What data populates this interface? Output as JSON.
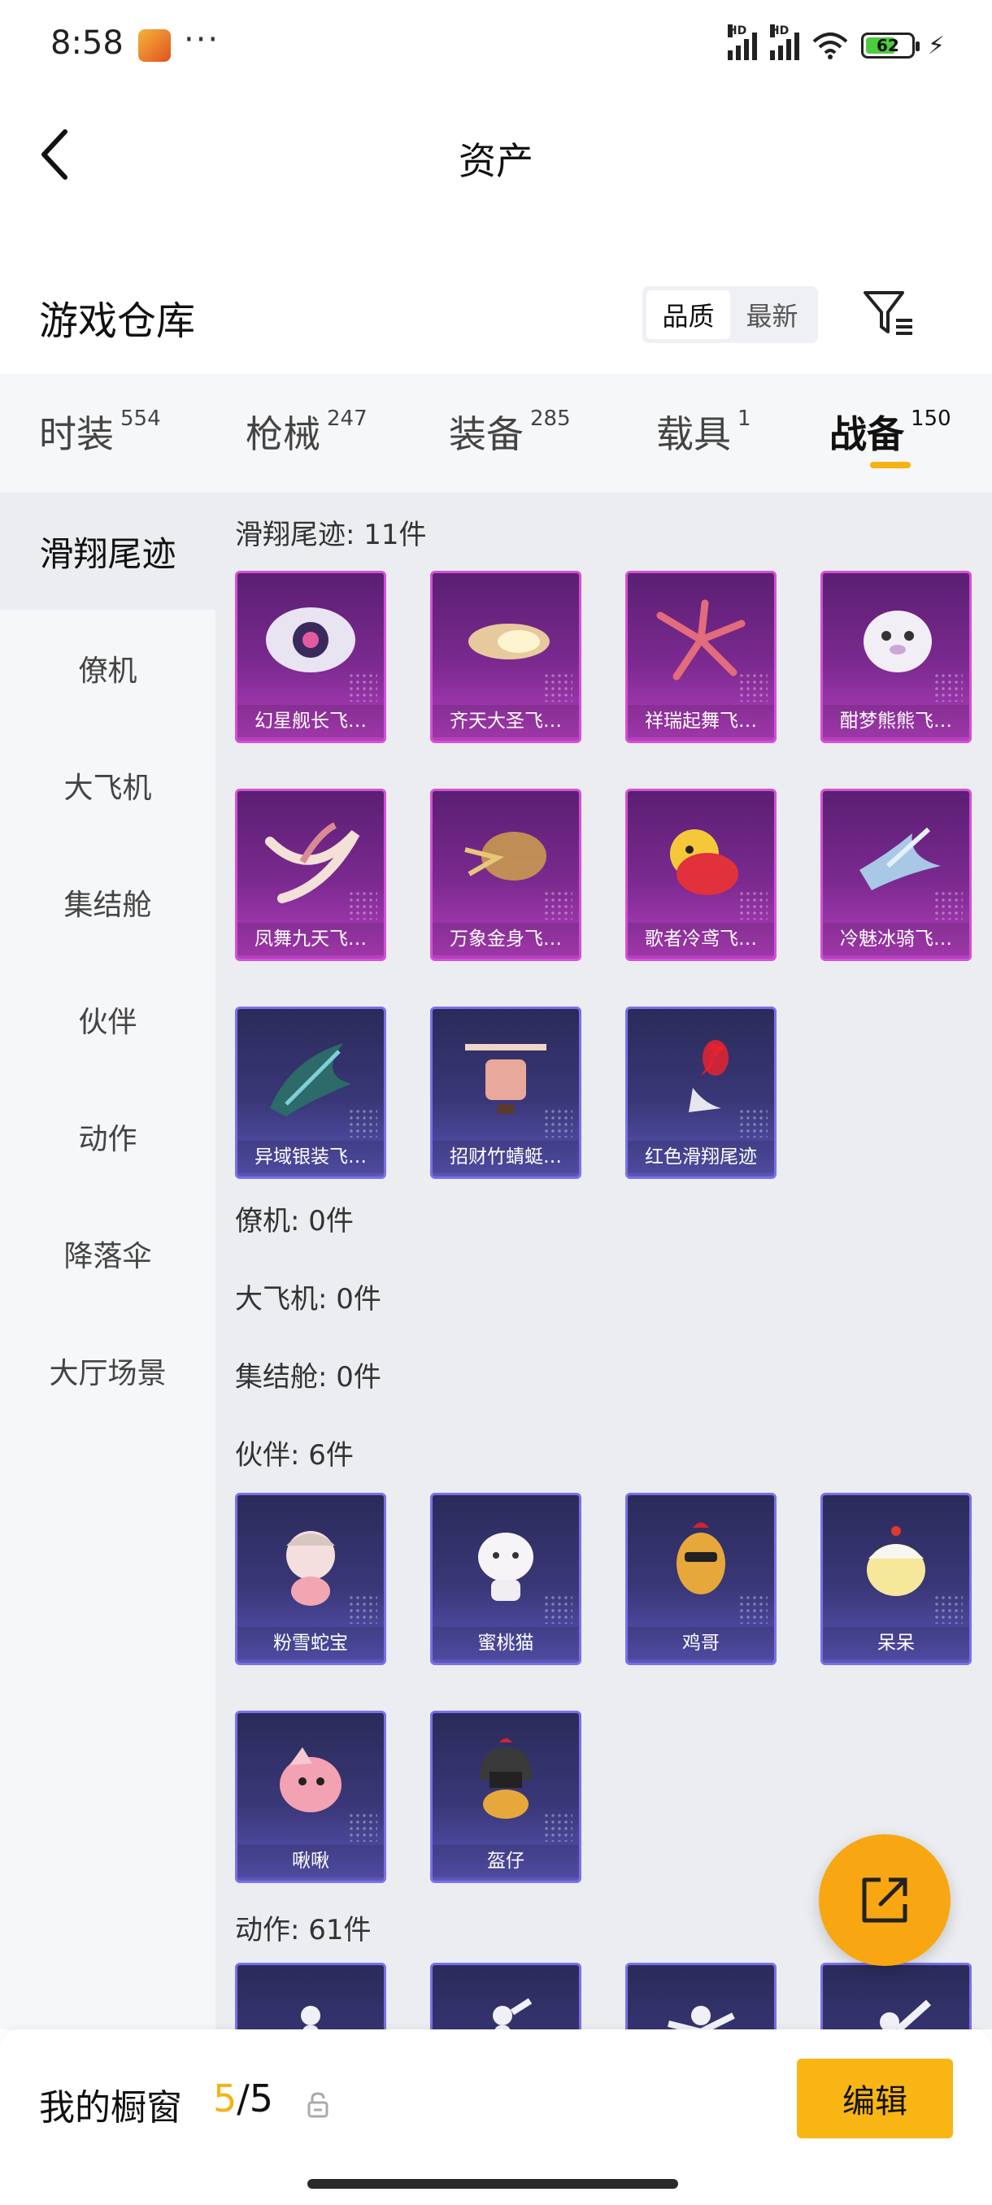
{
  "status_bar": {
    "time": "8:58",
    "dots": "···",
    "hd1": "HD",
    "hd2": "HD",
    "battery": "62"
  },
  "header": {
    "title": "资产"
  },
  "warehouse": {
    "title": "游戏仓库",
    "sort_options": [
      "品质",
      "最新"
    ],
    "active_sort": "品质"
  },
  "tabs": [
    {
      "label": "时装",
      "count": "554"
    },
    {
      "label": "枪械",
      "count": "247"
    },
    {
      "label": "装备",
      "count": "285"
    },
    {
      "label": "载具",
      "count": "1"
    },
    {
      "label": "战备",
      "count": "150"
    }
  ],
  "active_tab": "战备",
  "sidebar": [
    "滑翔尾迹",
    "僚机",
    "大飞机",
    "集结舱",
    "伙伴",
    "动作",
    "降落伞",
    "大厅场景"
  ],
  "active_sidebar": "滑翔尾迹",
  "sections": {
    "glide": {
      "label": "滑翔尾迹: 11件",
      "items": [
        "幻星舰长飞…",
        "齐天大圣飞…",
        "祥瑞起舞飞…",
        "酣梦熊熊飞…",
        "凤舞九天飞…",
        "万象金身飞…",
        "歌者冷鸢飞…",
        "冷魅冰骑飞…",
        "异域银装飞…",
        "招财竹蜻蜓…",
        "红色滑翔尾迹"
      ]
    },
    "wingman": {
      "label": "僚机: 0件"
    },
    "plane": {
      "label": "大飞机: 0件"
    },
    "pod": {
      "label": "集结舱: 0件"
    },
    "companion": {
      "label": "伙伴: 6件",
      "items": [
        "粉雪蛇宝",
        "蜜桃猫",
        "鸡哥",
        "呆呆",
        "啾啾",
        "盔仔"
      ]
    },
    "emote": {
      "label": "动作: 61件"
    }
  },
  "bottom": {
    "showcase_label": "我的橱窗",
    "current": "5",
    "total": "/5",
    "edit_label": "编辑"
  },
  "colors": {
    "accent": "#f5b315",
    "purple_rarity": "#d44fd8",
    "blue_rarity": "#7a70e8"
  },
  "icons": [
    "back-icon",
    "filter-icon",
    "share-icon",
    "lock-icon",
    "wifi-icon",
    "battery-icon"
  ]
}
